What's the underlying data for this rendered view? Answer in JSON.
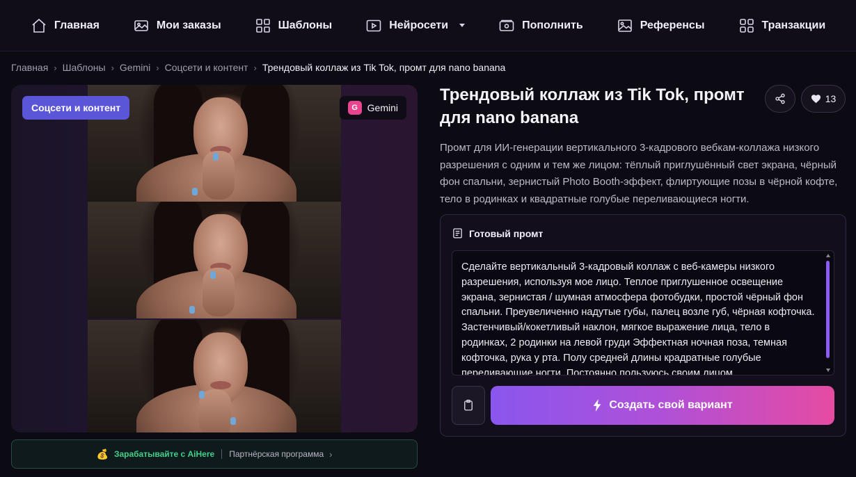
{
  "nav": {
    "items": [
      {
        "label": "Главная",
        "icon": "home-icon"
      },
      {
        "label": "Мои заказы",
        "icon": "image-icon"
      },
      {
        "label": "Шаблоны",
        "icon": "grid-icon"
      },
      {
        "label": "Нейросети",
        "icon": "play-icon"
      },
      {
        "label": "Пополнить",
        "icon": "wallet-icon"
      },
      {
        "label": "Референсы",
        "icon": "picture-icon"
      },
      {
        "label": "Транзакции",
        "icon": "squares-icon"
      }
    ]
  },
  "breadcrumb": {
    "items": [
      "Главная",
      "Шаблоны",
      "Gemini",
      "Соцсети и контент"
    ],
    "separator": "›",
    "current": "Трендовый коллаж из Tik Tok, промт для nano banana"
  },
  "card": {
    "category": "Соцсети и контент",
    "model": "Gemini",
    "model_initial": "G"
  },
  "affiliate": {
    "icon": "money-bag-icon",
    "earn": "Зарабатывайте с AiHere",
    "partner": "Партнёрская программа"
  },
  "detail": {
    "title": "Трендовый коллаж из Tik Tok, промт для nano banana",
    "likes": "13",
    "description": "Промт для ИИ-генерации вертикального 3-кадрового вебкам-коллажа низкого разрешения с одним и тем же лицом: тёплый приглушённый свет экрана, чёрный фон спальни, зернистый Photo Booth-эффект, флиртующие позы в чёрной кофте, тело в родинках и квадратные голубые переливающиеся ногти."
  },
  "prompt": {
    "heading": "Готовый промт",
    "text": "Сделайте вертикальный 3-кадровый коллаж с веб-камеры низкого разрешения, используя мое лицо. Теплое приглушенное освещение экрана, зернистая / шумная атмосфера фотобудки, простой чёрный фон спальни. Преувеличенно надутые губы, палец возле губ, чёрная кофточка. Застенчивый/кокетливый наклон, мягкое выражение лица, тело в родинках, 2 родинки на левой груди Эффектная ночная поза, темная кофточка, рука у рта. Полу средней длины крадратные голубые переливающие ногти. Постоянно пользуюсь своим лицом.",
    "create_label": "Создать свой вариант"
  },
  "colors": {
    "accent": "#5b55d8",
    "button_gradient_start": "#8a56ee",
    "button_gradient_end": "#e64ba2",
    "scroll_thumb": "#8b5cf6"
  }
}
